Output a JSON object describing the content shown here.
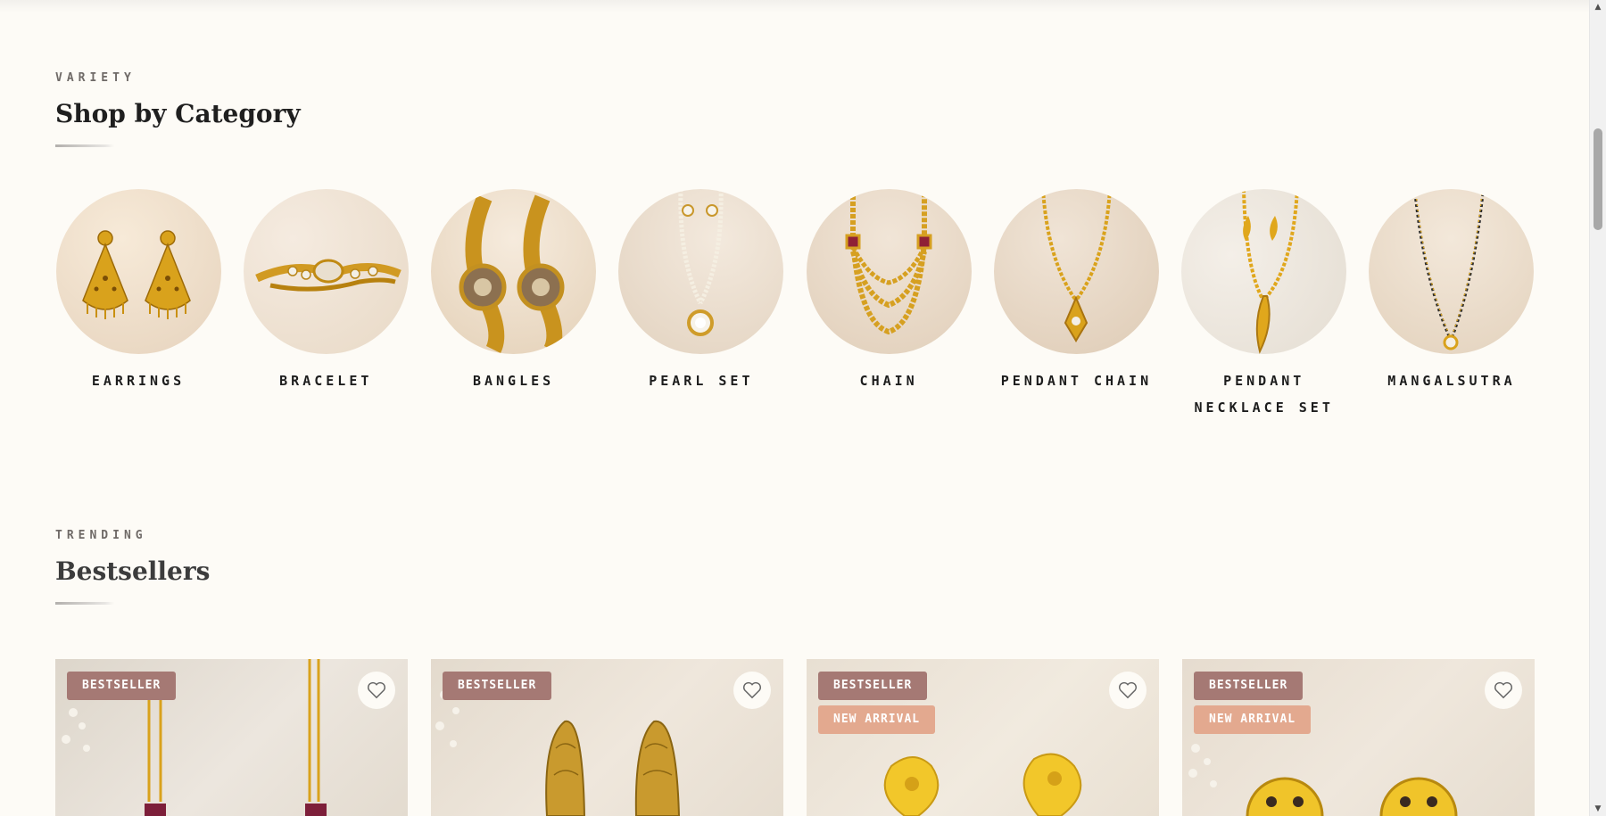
{
  "category_section": {
    "eyebrow": "VARIETY",
    "title": "Shop by Category",
    "items": [
      {
        "label": "EARRINGS",
        "icon": "earrings-image"
      },
      {
        "label": "BRACELET",
        "icon": "bracelet-image"
      },
      {
        "label": "BANGLES",
        "icon": "bangles-image"
      },
      {
        "label": "PEARL SET",
        "icon": "pearl-set-image"
      },
      {
        "label": "CHAIN",
        "icon": "chain-image"
      },
      {
        "label": "PENDANT CHAIN",
        "icon": "pendant-chain-image"
      },
      {
        "label": "PENDANT NECKLACE SET",
        "icon": "pendant-necklace-set-image"
      },
      {
        "label": "MANGALSUTRA",
        "icon": "mangalsutra-image"
      }
    ]
  },
  "bestseller_section": {
    "eyebrow": "TRENDING",
    "title": "Bestsellers",
    "products": [
      {
        "badges": [
          "BESTSELLER"
        ]
      },
      {
        "badges": [
          "BESTSELLER"
        ]
      },
      {
        "badges": [
          "BESTSELLER",
          "NEW ARRIVAL"
        ]
      },
      {
        "badges": [
          "BESTSELLER",
          "NEW ARRIVAL"
        ]
      }
    ]
  },
  "colors": {
    "background": "#fdfbf6",
    "bestseller_badge": "#a57974",
    "new_arrival_badge": "#e3a98f",
    "gold": "#d9a21c"
  }
}
